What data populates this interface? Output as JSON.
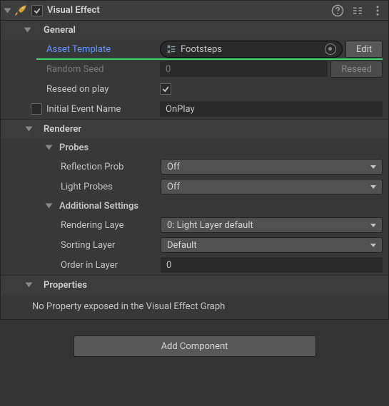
{
  "header": {
    "title": "Visual Effect",
    "enabled": true
  },
  "sections": {
    "general": {
      "title": "General",
      "asset_template": {
        "label": "Asset Template",
        "value": "Footsteps",
        "edit": "Edit"
      },
      "random_seed": {
        "label": "Random Seed",
        "value": "0",
        "reseed": "Reseed"
      },
      "reseed_on_play": {
        "label": "Reseed on play",
        "checked": true
      },
      "initial_event": {
        "label": "Initial Event Name",
        "value": "OnPlay",
        "enabled": false
      }
    },
    "renderer": {
      "title": "Renderer",
      "probes": {
        "title": "Probes",
        "reflection": {
          "label": "Reflection Prob",
          "value": "Off"
        },
        "light": {
          "label": "Light Probes",
          "value": "Off"
        }
      },
      "additional": {
        "title": "Additional Settings",
        "rendering_layer": {
          "label": "Rendering Laye",
          "value": "0: Light Layer default"
        },
        "sorting_layer": {
          "label": "Sorting Layer",
          "value": "Default"
        },
        "order_in_layer": {
          "label": "Order in Layer",
          "value": "0"
        }
      }
    },
    "properties": {
      "title": "Properties",
      "empty": "No Property exposed in the Visual Effect Graph"
    }
  },
  "footer": {
    "add_component": "Add Component"
  }
}
